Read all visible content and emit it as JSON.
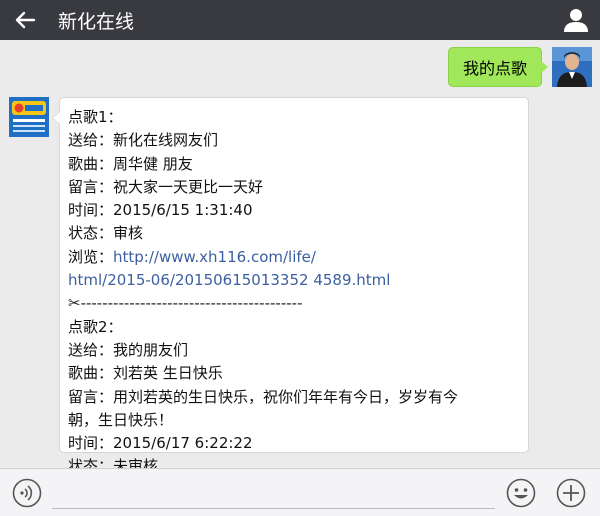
{
  "header": {
    "title": "新化在线",
    "back_icon": "arrow-left-icon",
    "profile_icon": "person-icon"
  },
  "messages": {
    "outgoing": {
      "text": "我的点歌"
    },
    "incoming": {
      "lines": [
        "点歌1：",
        "送给：新化在线网友们",
        "歌曲：周华健 朋友",
        "留言：祝大家一天更比一天好",
        "时间：2015/6/15 1:31:40",
        "状态：审核"
      ],
      "browse_label": "浏览：",
      "link_part1": "http://www.xh116.com/life/",
      "link_part2": "html/2015-06/20150615013352 4589.html",
      "separator": "✂-----------------------------------------",
      "lines2": [
        "点歌2：",
        "送给：我的朋友们",
        "歌曲：刘若英 生日快乐",
        "留言：用刘若英的生日快乐，祝你们年年有今日，岁岁有今",
        "朝，生日快乐！",
        "时间：2015/6/17 6:22:22",
        "状态：未审核"
      ]
    }
  },
  "footer": {
    "voice_icon": "voice-icon",
    "input_value": "",
    "emoji_icon": "emoji-icon",
    "plus_icon": "plus-icon"
  },
  "colors": {
    "header_bg": "#393a3f",
    "chat_bg": "#ebebeb",
    "outgoing_bubble": "#a0e75a",
    "link": "#3b5fa0"
  }
}
